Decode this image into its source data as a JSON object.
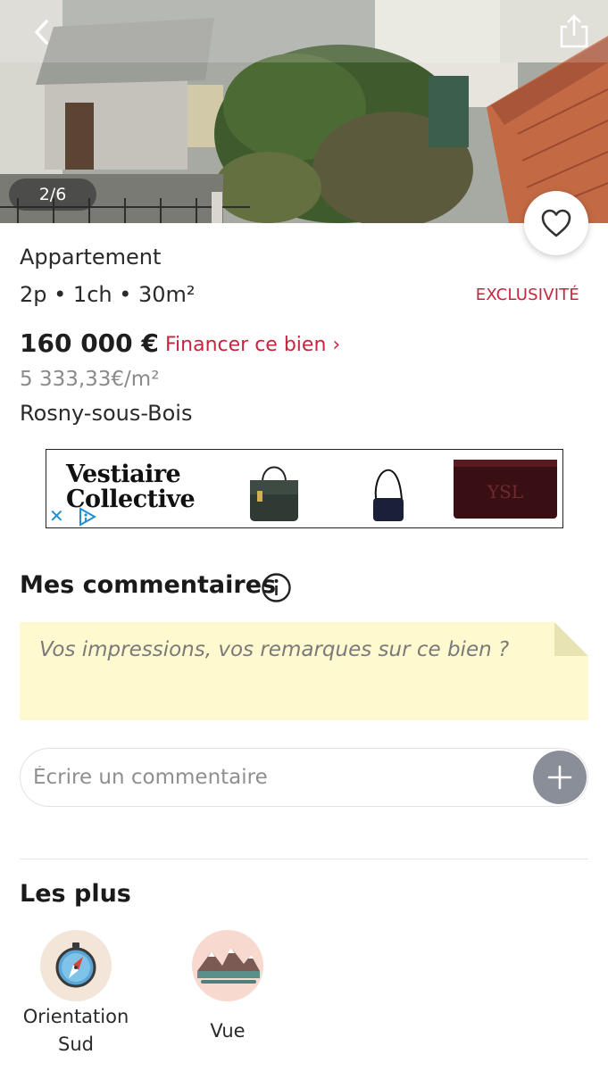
{
  "gallery": {
    "counter": "2/6",
    "icons": {
      "back": "chevron-left-icon",
      "share": "share-icon",
      "favorite": "heart-icon"
    }
  },
  "listing": {
    "type": "Appartement",
    "specs": "2p • 1ch • 30m²",
    "badge": "EXCLUSIVITÉ",
    "price": "160 000 €",
    "finance_link": "Financer ce bien ›",
    "price_per_m2": "5 333,33€/m²",
    "city": "Rosny-sous-Bois"
  },
  "ad": {
    "brand_line1": "Vestiaire",
    "brand_line2": "Collective",
    "close_label": "✕",
    "icons": {
      "close": "close-icon",
      "adchoices": "adchoices-icon"
    }
  },
  "comments": {
    "title": "Mes commentaires",
    "note_placeholder": "Vos impressions, vos remarques sur ce bien ?",
    "input_placeholder": "Écrire un commentaire",
    "icons": {
      "info": "info-icon",
      "add": "plus-icon"
    }
  },
  "features": {
    "title": "Les plus",
    "items": [
      {
        "line1": "Orientation",
        "line2": "Sud",
        "icon": "compass-icon"
      },
      {
        "line1": "Vue",
        "line2": "",
        "icon": "mountains-icon"
      }
    ]
  },
  "colors": {
    "accent_red": "#c8243d",
    "note_bg": "#fef9cf",
    "add_button": "#8a8e99",
    "compass_bg": "#f3e6d9",
    "view_bg": "#f7d9cf"
  }
}
